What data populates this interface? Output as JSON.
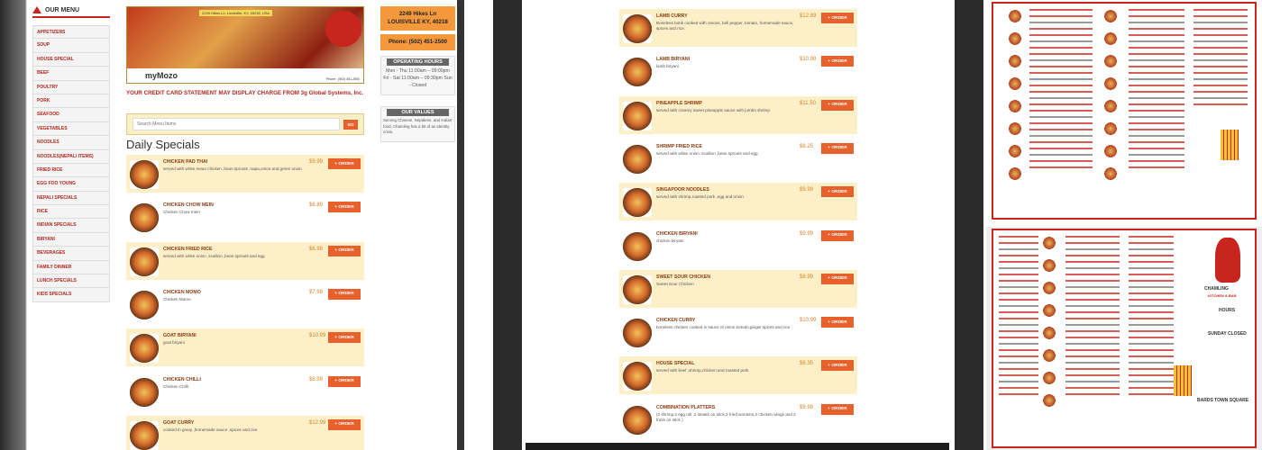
{
  "sidebar": {
    "title": "OUR MENU",
    "items": [
      "APPETIZERS",
      "SOUP",
      "HOUSE SPECIAL",
      "BEEF",
      "POULTRY",
      "PORK",
      "SEAFOOD",
      "VEGETABLES",
      "NOODLES",
      "NOODLES(NEPALI ITEMS)",
      "FRIED RICE",
      "EGG FOO YOUNG",
      "NEPALI SPECIALS",
      "RICE",
      "INDIAN SPECIALS",
      "BIRYANI",
      "BEVERAGES",
      "FAMILY DINNER",
      "LUNCH SPECIALS",
      "KIDS SPECIALS"
    ]
  },
  "banner": {
    "address": "2249 Hikes Ln, Louisville, KY, 40218, USA",
    "logo": "CHAMLING KITCHEN & BAR",
    "brand": "myMozo",
    "phone": "Phone : (502) 451-2500"
  },
  "notice": "YOUR CREDIT CARD STATEMENT MAY DISPLAY CHARGE FROM 3g Global Systems, Inc.",
  "search": {
    "placeholder": "Search Menu Items",
    "button": "GO"
  },
  "section_title": "Daily Specials",
  "order_label": "+ ORDER",
  "info": {
    "address_line1": "2249 Hikes Ln",
    "address_line2": "LOUISVILLE KY, 40218",
    "phone": "Phone: (502) 451-2500",
    "hours_title": "OPERATING HOURS",
    "hours_text": "Mon - Thu 11:00am – 09:00pm Fri - Sat 11:00am – 09:30pm Sun - Closed",
    "values_title": "OUR VALUES",
    "values_text": "Serving Chinese, Nepalese, and Indian food, Chamling has a bit of an identity crisis."
  },
  "items_left": [
    {
      "name": "CHICKEN PAD THAI",
      "desc": "served with white mean chicken ,bean sprouts ,napa,onion and green onion",
      "price": "$9.99"
    },
    {
      "name": "CHICKEN CHOW MEIN",
      "desc": "Chicken Chow mein",
      "price": "$6.89"
    },
    {
      "name": "CHICKEN FRIED RICE",
      "desc": "served with white onion ,scallion ,bean sprouts and egg",
      "price": "$6.99"
    },
    {
      "name": "CHICKEN MOMO",
      "desc": "Chicken Momo",
      "price": "$7.99"
    },
    {
      "name": "GOAT BIRYANI",
      "desc": "goat biryani",
      "price": "$10.99"
    },
    {
      "name": "CHICKEN CHILLI",
      "desc": "Chicken Chilli",
      "price": "$8.99"
    },
    {
      "name": "GOAT CURRY",
      "desc": "cooked in gravy ,homemade sauce ,spices and rice",
      "price": "$12.99"
    }
  ],
  "items_right": [
    {
      "name": "LAMB CURRY",
      "desc": "Boneless lamb cooked with onions, bell pepper, tomato, homemade sauce, spices and rice.",
      "price": "$12.99"
    },
    {
      "name": "LAMB BIRYANI",
      "desc": "lamb biryani",
      "price": "$10.99"
    },
    {
      "name": "PINEAPPLE SHRIMP",
      "desc": "served with creamy sweet pineapple sauce with jumbo shrimp",
      "price": "$11.50"
    },
    {
      "name": "SHRIMP FRIED RICE",
      "desc": "served with white onion ,scallion ,bean sprouts and egg",
      "price": "$8.25"
    },
    {
      "name": "SINGAPOOR NOODLES",
      "desc": "served with shrimp,roasted pork ,egg and onion",
      "price": "$9.99"
    },
    {
      "name": "CHICKEN BIRYANI",
      "desc": "chicken biryani",
      "price": "$9.99"
    },
    {
      "name": "SWEET SOUR CHICKEN",
      "desc": "Sweet Sour Chicken",
      "price": "$8.99"
    },
    {
      "name": "CHICKEN CURRY",
      "desc": "boneless chicken cooked in sauce of onion,tomato,ginger,spices and rice",
      "price": "$10.99"
    },
    {
      "name": "HOUSE SPECIAL",
      "desc": "served with beef ,shrimp,chicken and roasted pork",
      "price": "$8.35"
    },
    {
      "name": "COMBINATION PLATTERS",
      "desc": "(2 shrimp,2 egg roll ,2 steaks on stick,2 fried wontons,2 chicken wings and 2 fruits on stick )",
      "price": "$9.99"
    }
  ],
  "photo_menu": {
    "bottom_logo": "CHAMLING",
    "bottom_sub": "KITCHEN & BAR",
    "plaza": "BARDS TOWN SQUARE",
    "hours": "HOURS",
    "sunday": "SUNDAY CLOSED"
  },
  "colors": {
    "accent": "#e8602c",
    "brand_red": "#c8251f",
    "row_alt": "#fdefc8",
    "price": "#d2862a"
  }
}
